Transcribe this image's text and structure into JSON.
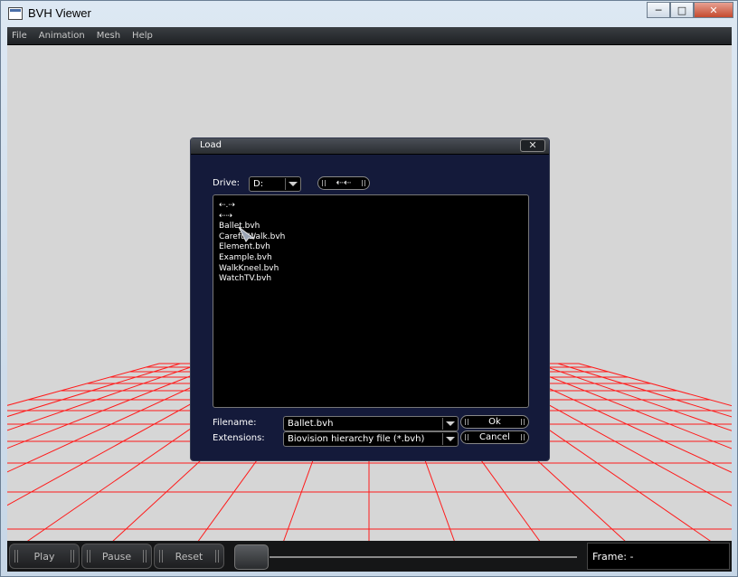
{
  "window": {
    "title": "BVH Viewer",
    "controls": {
      "minimize": "─",
      "maximize": "□",
      "close": "✕"
    }
  },
  "menubar": [
    "File",
    "Animation",
    "Mesh",
    "Help"
  ],
  "dialog": {
    "title": "Load",
    "close_glyph": "✕",
    "drive_label": "Drive:",
    "drive_value": "D:",
    "up_button": "⇠⇠",
    "files": [
      "⇠.⇢",
      "⇠⇢",
      "Ballet.bvh",
      "CarefulWalk.bvh",
      "Element.bvh",
      "Example.bvh",
      "WalkKneel.bvh",
      "WatchTV.bvh"
    ],
    "filename_label": "Filename:",
    "filename_value": "Ballet.bvh",
    "extensions_label": "Extensions:",
    "extensions_value": "Biovision hierarchy file (*.bvh)",
    "ok_label": "Ok",
    "cancel_label": "Cancel"
  },
  "toolbar": {
    "play": "Play",
    "pause": "Pause",
    "reset": "Reset",
    "frame_label": "Frame: -"
  },
  "colors": {
    "grid": "#ff1a1a",
    "background": "#d6d6d6",
    "dialog": "#141a3a"
  }
}
